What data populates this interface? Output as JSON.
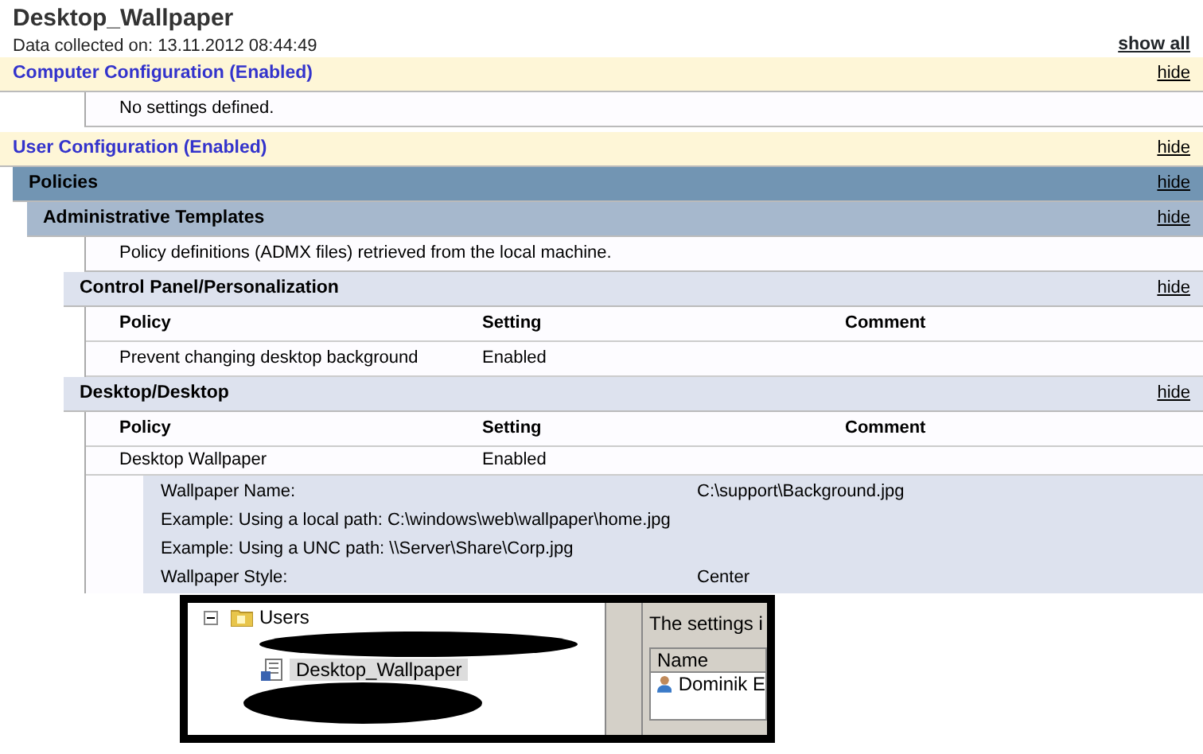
{
  "report": {
    "title": "Desktop_Wallpaper",
    "collected": "Data collected on: 13.11.2012 08:44:49",
    "show_all": "show all"
  },
  "sections": [
    {
      "kind": "config",
      "title": "Computer Configuration (Enabled)",
      "action": "hide",
      "children": [
        {
          "kind": "note",
          "text": "No settings defined."
        }
      ]
    },
    {
      "kind": "config",
      "title": "User Configuration (Enabled)",
      "action": "hide",
      "children": [
        {
          "kind": "group",
          "title": "Policies",
          "action": "hide",
          "children": [
            {
              "kind": "group",
              "title": "Administrative Templates",
              "action": "hide",
              "children": [
                {
                  "kind": "note",
                  "text": "Policy definitions (ADMX files) retrieved from the local machine."
                },
                {
                  "kind": "category",
                  "title": "Control Panel/Personalization",
                  "action": "hide",
                  "columns": [
                    "Policy",
                    "Setting",
                    "Comment"
                  ],
                  "rows": [
                    {
                      "cells": [
                        "Prevent changing desktop background",
                        "Enabled"
                      ]
                    }
                  ]
                },
                {
                  "kind": "category",
                  "title": "Desktop/Desktop",
                  "action": "hide",
                  "columns": [
                    "Policy",
                    "Setting",
                    "Comment"
                  ],
                  "rows": [
                    {
                      "cells": [
                        "Desktop Wallpaper",
                        "Enabled"
                      ],
                      "details": [
                        [
                          "Wallpaper Name:",
                          "C:\\support\\Background.jpg"
                        ],
                        [
                          "Example: Using a local path: C:\\windows\\web\\wallpaper\\home.jpg"
                        ],
                        [
                          "Example: Using a UNC path: \\\\Server\\Share\\Corp.jpg"
                        ],
                        [
                          "Wallpaper Style:",
                          "Center"
                        ]
                      ]
                    }
                  ]
                }
              ]
            }
          ]
        }
      ]
    }
  ],
  "embedded_screenshot": {
    "tree": [
      {
        "label": "Users",
        "expanded": true,
        "children": [
          {
            "label": "Desktop_Wallpaper",
            "selected": true
          }
        ]
      }
    ],
    "pane_text": "The settings i",
    "column": "Name",
    "user": "Dominik E"
  }
}
